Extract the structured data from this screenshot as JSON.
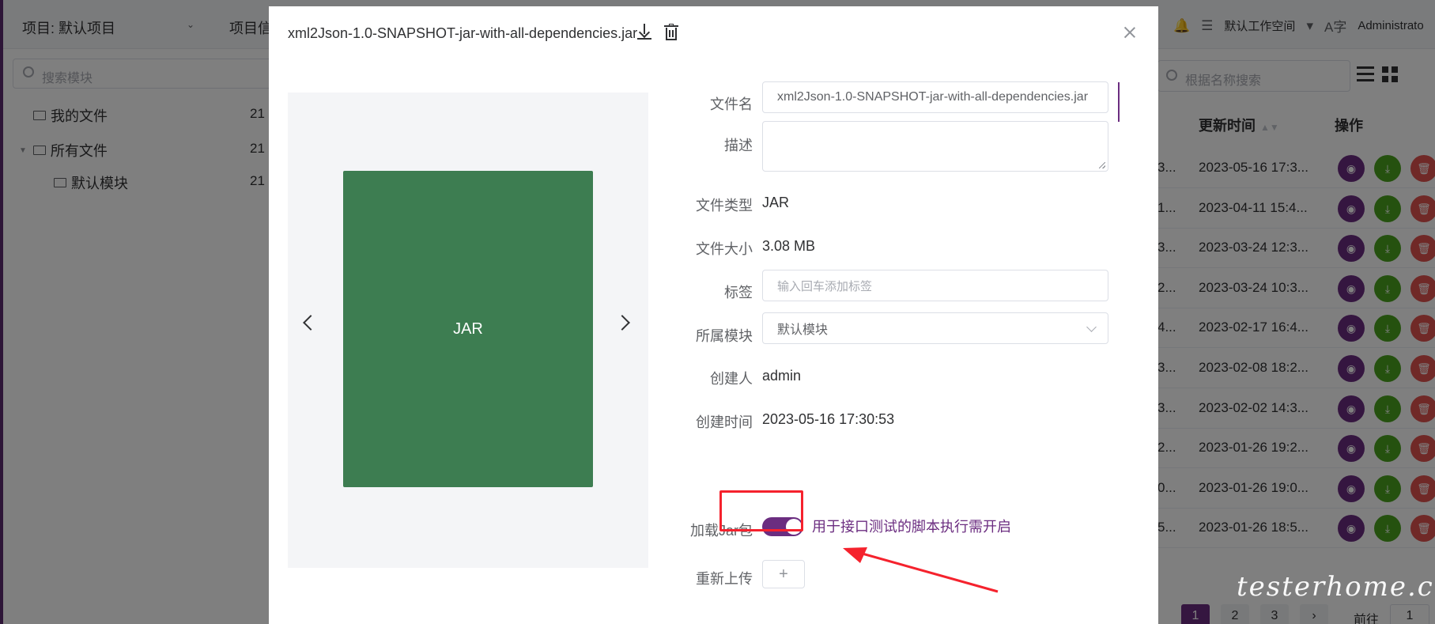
{
  "background": {
    "project_select": "项目: 默认项目",
    "project_info": "项目信",
    "workspace": "默认工作空间",
    "lang_icon": "A字",
    "user": "Administrato",
    "module_search_placeholder": "搜索模块",
    "tree": [
      {
        "label": "我的文件",
        "count": "21"
      },
      {
        "label": "所有文件",
        "count": "21"
      },
      {
        "label": "默认模块",
        "count": "21"
      }
    ],
    "name_search_placeholder": "根据名称搜索",
    "col_update_time": "更新时间",
    "col_ops": "操作",
    "rows": [
      {
        "trunc": "3...",
        "time": "2023-05-16 17:3..."
      },
      {
        "trunc": "1...",
        "time": "2023-04-11 15:4..."
      },
      {
        "trunc": "3...",
        "time": "2023-03-24 12:3..."
      },
      {
        "trunc": "2...",
        "time": "2023-03-24 10:3..."
      },
      {
        "trunc": "4...",
        "time": "2023-02-17 16:4..."
      },
      {
        "trunc": "3...",
        "time": "2023-02-08 18:2..."
      },
      {
        "trunc": "3...",
        "time": "2023-02-02 14:3..."
      },
      {
        "trunc": "2...",
        "time": "2023-01-26 19:2..."
      },
      {
        "trunc": "0...",
        "time": "2023-01-26 19:0..."
      },
      {
        "trunc": "5...",
        "time": "2023-01-26 18:5..."
      }
    ],
    "pager": {
      "pages": [
        "1",
        "2",
        "3"
      ],
      "goto": "前往",
      "goto_value": "1"
    }
  },
  "dialog": {
    "title": "xml2Json-1.0-SNAPSHOT-jar-with-all-dependencies.jar",
    "preview_label": "JAR",
    "fields": {
      "filename_label": "文件名",
      "filename_value": "xml2Json-1.0-SNAPSHOT-jar-with-all-dependencies.jar",
      "desc_label": "描述",
      "type_label": "文件类型",
      "type_value": "JAR",
      "size_label": "文件大小",
      "size_value": "3.08 MB",
      "tags_label": "标签",
      "tags_placeholder": "输入回车添加标签",
      "module_label": "所属模块",
      "module_value": "默认模块",
      "creator_label": "创建人",
      "creator_value": "admin",
      "created_label": "创建时间",
      "created_value": "2023-05-16 17:30:53",
      "loadjar_label": "加载Jar包",
      "loadjar_hint": "用于接口测试的脚本执行需开启",
      "loadjar_on": true,
      "reupload_label": "重新上传",
      "reupload_plus": "+"
    }
  },
  "watermark": "testerhome.com",
  "colors": {
    "accent": "#6b2d80",
    "jar_card": "#3d7d51",
    "highlight": "#f5222d"
  }
}
